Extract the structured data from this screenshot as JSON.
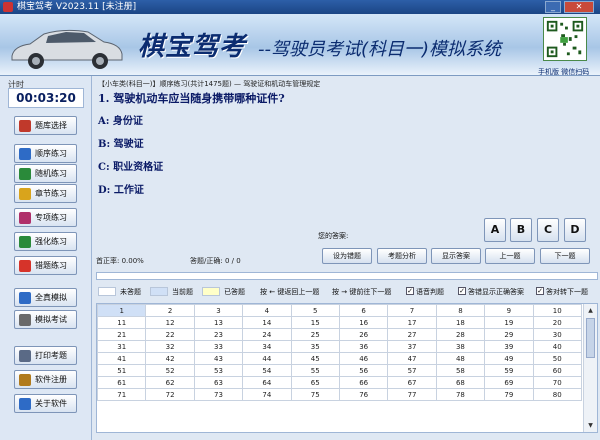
{
  "window": {
    "title": "棋宝驾考 V2023.11 [未注册]"
  },
  "banner": {
    "brand": "棋宝驾考",
    "subtitle": "--驾驶员考试(科目一)模拟系统",
    "qr_caption": "手机版 微信扫码"
  },
  "sidebar": {
    "timer_label": "计时",
    "timer": "00:03:20",
    "items": [
      {
        "label": "题库选择",
        "icon": "book-icon",
        "color": "#c0392b"
      },
      {
        "label": "顺序练习",
        "icon": "list-icon",
        "color": "#2e6bc6"
      },
      {
        "label": "随机练习",
        "icon": "shuffle-icon",
        "color": "#2a8a3a"
      },
      {
        "label": "章节练习",
        "icon": "folder-icon",
        "color": "#d9a41c"
      },
      {
        "label": "专项练习",
        "icon": "target-icon",
        "color": "#b0306a"
      },
      {
        "label": "强化练习",
        "icon": "flex-icon",
        "color": "#2a8a3a"
      },
      {
        "label": "错题练习",
        "icon": "flag-icon",
        "color": "#d6332a"
      },
      {
        "label": "全真模拟",
        "icon": "monitor-icon",
        "color": "#2e6bc6"
      },
      {
        "label": "模拟考试",
        "icon": "calendar-icon",
        "color": "#6a6a6a"
      },
      {
        "label": "打印考题",
        "icon": "printer-icon",
        "color": "#5a6a86"
      },
      {
        "label": "软件注册",
        "icon": "key-icon",
        "color": "#b07a1c"
      },
      {
        "label": "关于软件",
        "icon": "info-icon",
        "color": "#2e6bc6"
      }
    ]
  },
  "question": {
    "breadcrumb": "【小车类(科目一)】顺序练习(共计1475题) — 驾驶证和机动车管理规定",
    "text": "1. 驾驶机动车应当随身携带哪种证件?",
    "options": [
      "A: 身份证",
      "B: 驾驶证",
      "C: 职业资格证",
      "D: 工作证"
    ]
  },
  "answer": {
    "label": "您的答案:",
    "choices": [
      "A",
      "B",
      "C",
      "D"
    ]
  },
  "stats": {
    "accuracy": "首正率: 0.00%",
    "count": "答题/正确: 0 / 0"
  },
  "actions": [
    "设为错题",
    "考题分析",
    "显示答案",
    "上一题",
    "下一题"
  ],
  "legend": {
    "unanswered": "未答题",
    "current": "当前题",
    "answered": "已答题",
    "prev_hint": "按 ← 键返回上一题",
    "next_hint": "按 → 键前往下一题",
    "voice": "语音判题",
    "show_correct": "答错显示正确答案",
    "auto_next": "答对转下一题",
    "colors": {
      "unanswered": "#ffffff",
      "current": "#d0e0f6",
      "answered": "#ffffc8"
    }
  },
  "grid": {
    "rows": [
      [
        "1",
        "2",
        "3",
        "4",
        "5",
        "6",
        "7",
        "8",
        "9",
        "10"
      ],
      [
        "11",
        "12",
        "13",
        "14",
        "15",
        "16",
        "17",
        "18",
        "19",
        "20"
      ],
      [
        "21",
        "22",
        "23",
        "24",
        "25",
        "26",
        "27",
        "28",
        "29",
        "30"
      ],
      [
        "31",
        "32",
        "33",
        "34",
        "35",
        "36",
        "37",
        "38",
        "39",
        "40"
      ],
      [
        "41",
        "42",
        "43",
        "44",
        "45",
        "46",
        "47",
        "48",
        "49",
        "50"
      ],
      [
        "51",
        "52",
        "53",
        "54",
        "55",
        "56",
        "57",
        "58",
        "59",
        "60"
      ],
      [
        "61",
        "62",
        "63",
        "64",
        "65",
        "66",
        "67",
        "68",
        "69",
        "70"
      ],
      [
        "71",
        "72",
        "73",
        "74",
        "75",
        "76",
        "77",
        "78",
        "79",
        "80"
      ]
    ]
  }
}
